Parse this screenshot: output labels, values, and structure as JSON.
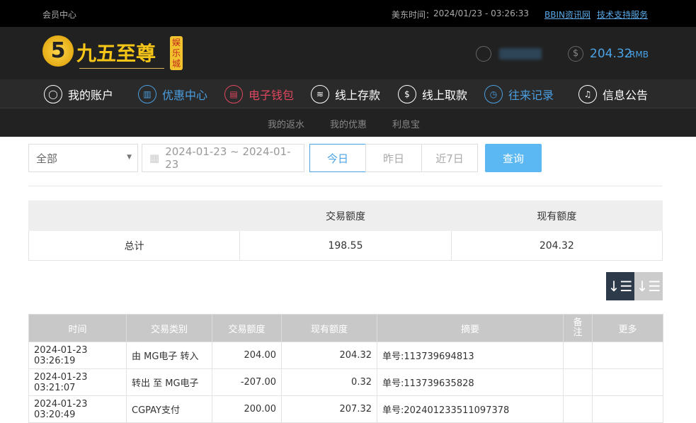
{
  "topbar": {
    "title": "会员中心",
    "time_label": "美东时间：",
    "time": "2024/01/23 - 03:26:33",
    "links": [
      "BBIN资讯网",
      "技术支持服务"
    ]
  },
  "header": {
    "logo_text": "九五至尊",
    "logo_badge": "娱乐城",
    "balance": "204.32",
    "currency": "RMB"
  },
  "nav": [
    {
      "label": "我的账户",
      "color": "#ffffff",
      "icon": "user-icon"
    },
    {
      "label": "优惠中心",
      "color": "#4a9fe0",
      "icon": "gift-icon"
    },
    {
      "label": "电子钱包",
      "color": "#e0475f",
      "icon": "wallet-icon"
    },
    {
      "label": "线上存款",
      "color": "#ffffff",
      "icon": "deposit-icon"
    },
    {
      "label": "线上取款",
      "color": "#ffffff",
      "icon": "withdraw-icon"
    },
    {
      "label": "往来记录",
      "color": "#4a9fe0",
      "icon": "record-icon"
    },
    {
      "label": "信息公告",
      "color": "#ffffff",
      "icon": "bell-icon"
    }
  ],
  "subnav": [
    "我的返水",
    "我的优惠",
    "利息宝"
  ],
  "filter": {
    "type": "全部",
    "date_range": "2024-01-23 ~ 2024-01-23",
    "quick": [
      "今日",
      "昨日",
      "近7日"
    ],
    "query": "查询"
  },
  "summary": {
    "headers": [
      "",
      "交易额度",
      "现有额度"
    ],
    "row": [
      "总计",
      "198.55",
      "204.32"
    ]
  },
  "table": {
    "headers": [
      "时间",
      "交易类别",
      "交易额度",
      "现有额度",
      "摘要",
      "备注",
      "更多"
    ],
    "rows": [
      [
        "2024-01-23 03:26:19",
        "由 MG电子 转入",
        "204.00",
        "204.32",
        "单号:113739694813",
        "",
        ""
      ],
      [
        "2024-01-23 03:21:07",
        "转出 至 MG电子",
        "-207.00",
        "0.32",
        "单号:113739635828",
        "",
        ""
      ],
      [
        "2024-01-23 03:20:49",
        "CGPAY支付",
        "200.00",
        "207.32",
        "单号:202401233511097378",
        "",
        ""
      ]
    ]
  }
}
